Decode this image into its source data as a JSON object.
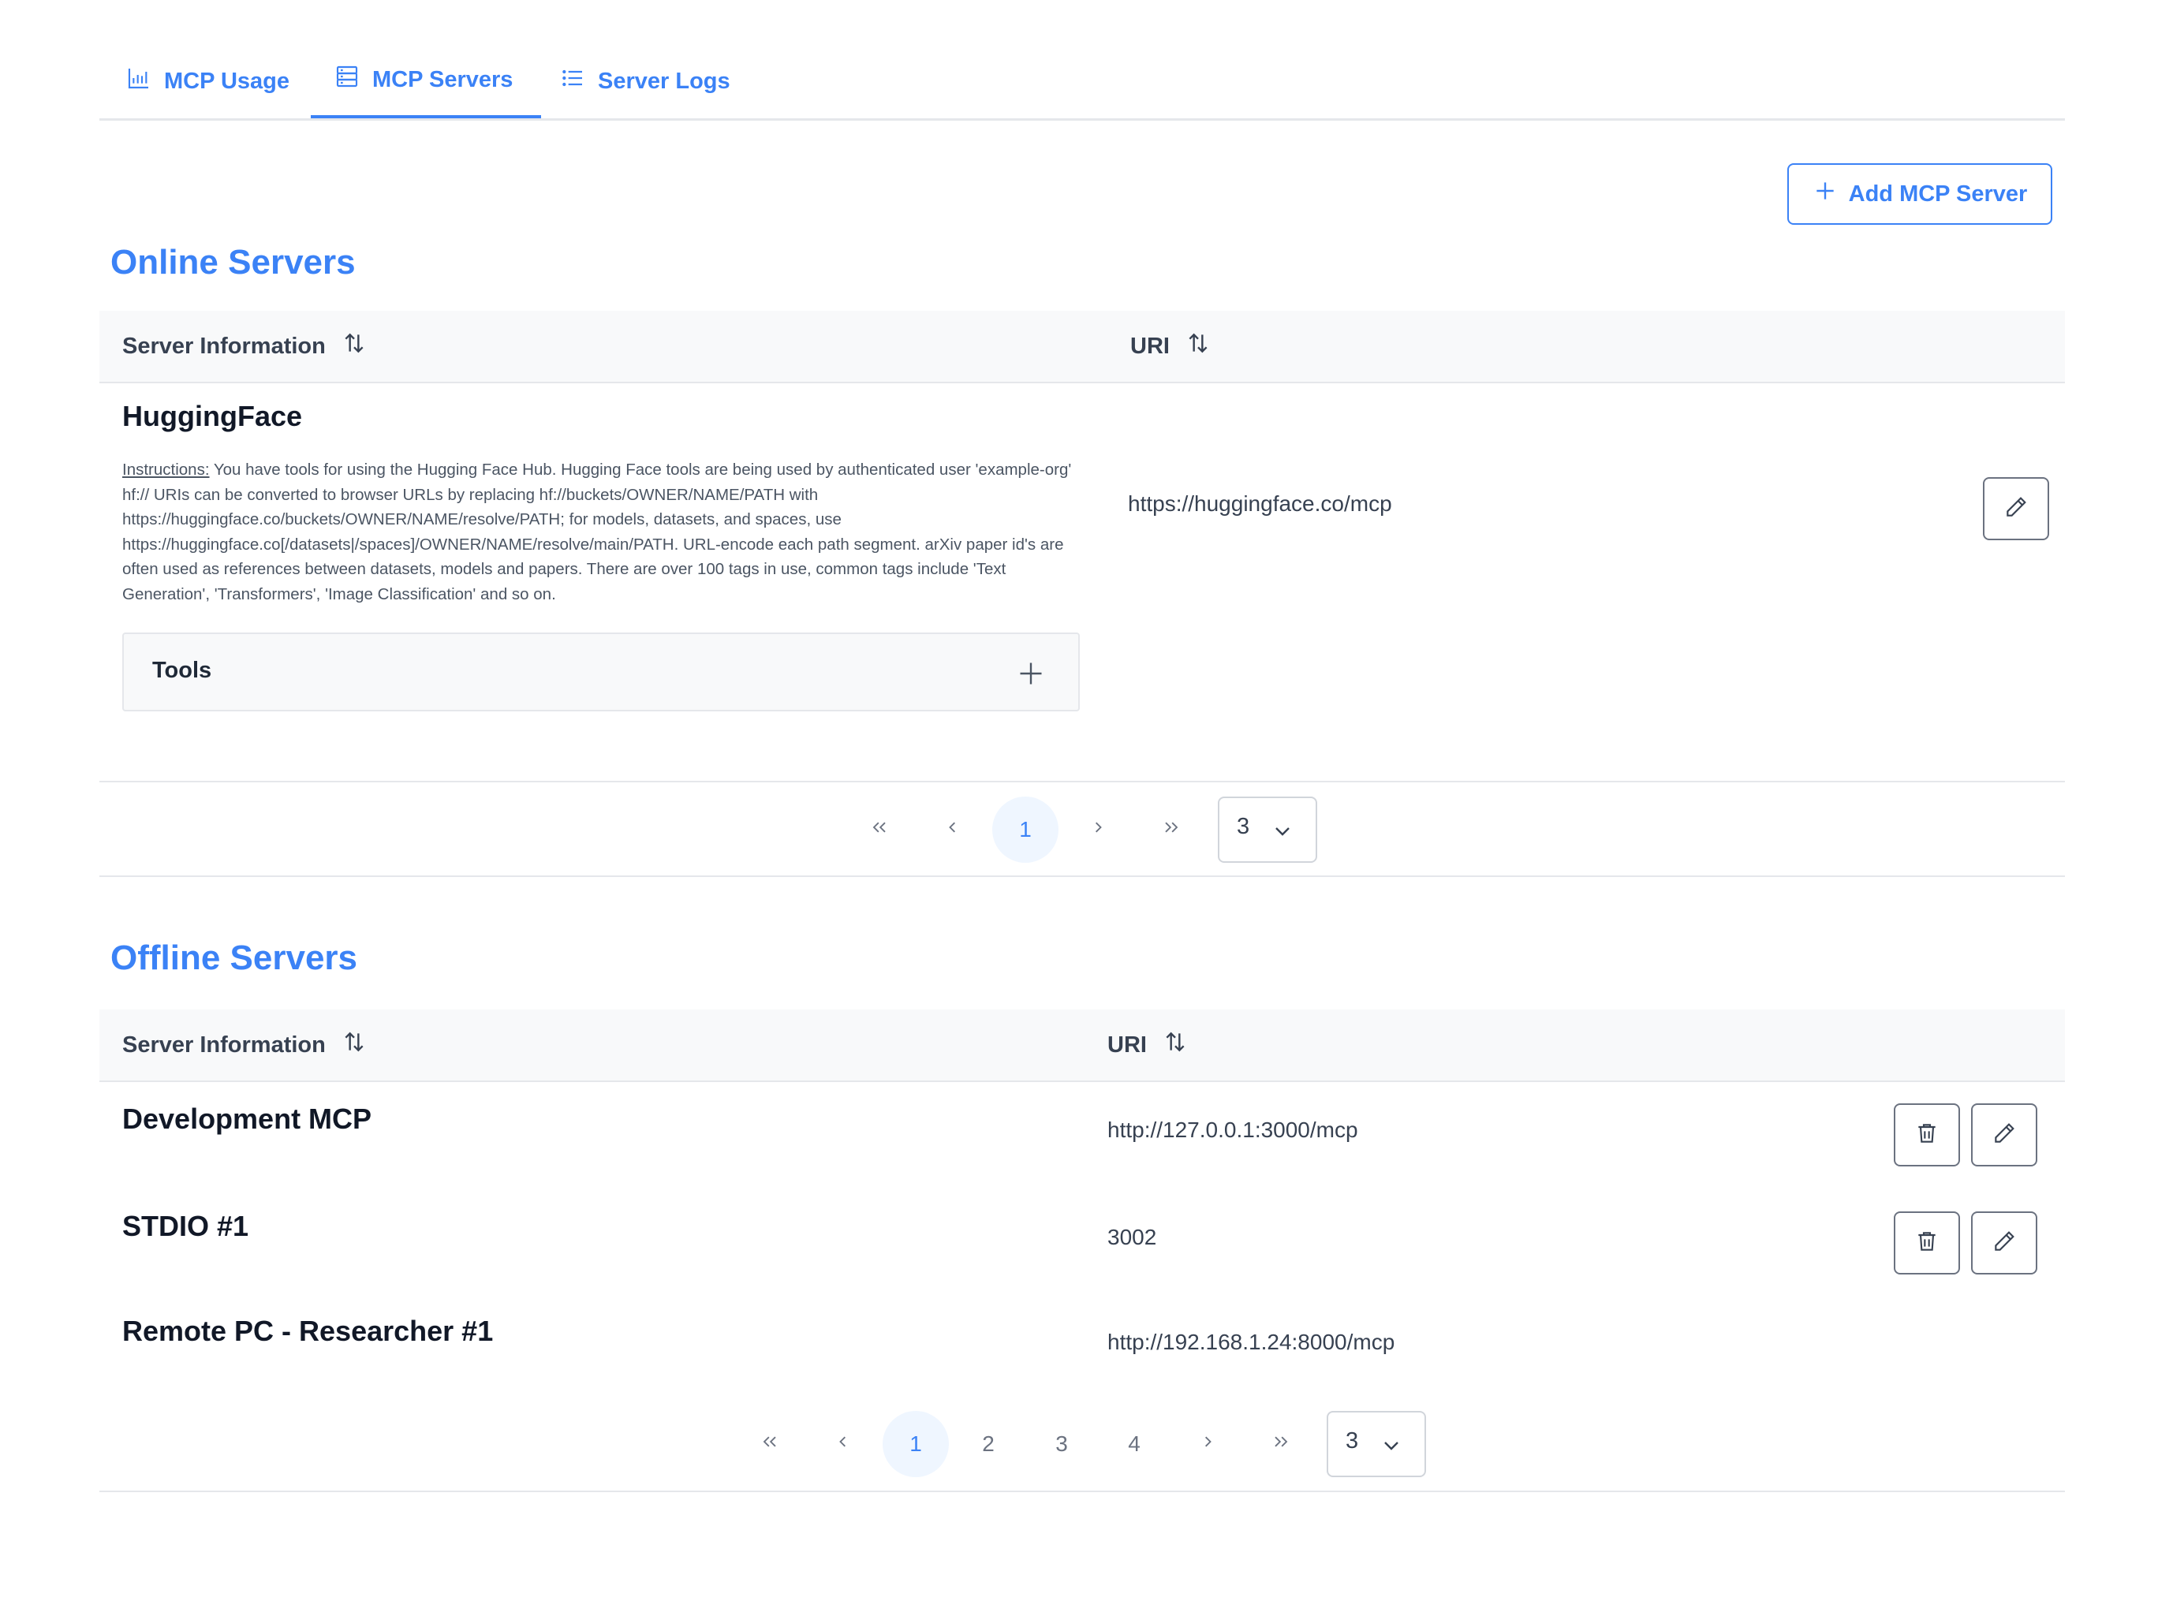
{
  "tabs": [
    {
      "label": "MCP Usage",
      "icon": "bar-chart-icon"
    },
    {
      "label": "MCP Servers",
      "icon": "server-icon",
      "active": true
    },
    {
      "label": "Server Logs",
      "icon": "list-icon"
    }
  ],
  "add_button": {
    "label": "Add MCP Server",
    "icon": "plus-icon"
  },
  "online": {
    "title": "Online Servers",
    "headers": {
      "info": "Server Information",
      "uri": "URI"
    },
    "servers": [
      {
        "name": "HuggingFace",
        "instructions_label": "Instructions:",
        "instructions": " You have tools for using the Hugging Face Hub. Hugging Face tools are being used by authenticated user 'example-org' hf:// URIs can be converted to browser URLs by replacing hf://buckets/OWNER/NAME/PATH with https://huggingface.co/buckets/OWNER/NAME/resolve/PATH; for models, datasets, and spaces, use https://huggingface.co[/datasets|/spaces]/OWNER/NAME/resolve/main/PATH. URL-encode each path segment. arXiv paper id's are often used as references between datasets, models and papers. There are over 100 tags in use, common tags include 'Text Generation', 'Transformers', 'Image Classification' and so on.",
        "tools_label": "Tools",
        "uri": "https://huggingface.co/mcp"
      }
    ],
    "pagination": {
      "pages": [
        "1"
      ],
      "current": "1",
      "rows_per_page": "3"
    }
  },
  "offline": {
    "title": "Offline Servers",
    "headers": {
      "info": "Server Information",
      "uri": "URI"
    },
    "servers": [
      {
        "name": "Development MCP",
        "uri": "http://127.0.0.1:3000/mcp"
      },
      {
        "name": "STDIO #1",
        "uri": "3002"
      },
      {
        "name": "Remote PC - Researcher #1",
        "uri": "http://192.168.1.24:8000/mcp"
      }
    ],
    "pagination": {
      "pages": [
        "1",
        "2",
        "3",
        "4"
      ],
      "current": "1",
      "rows_per_page": "3"
    }
  },
  "colors": {
    "accent": "#3b82f6",
    "header_bg": "#f8f9fa",
    "border": "#e5e7eb",
    "text": "#1f2937"
  }
}
